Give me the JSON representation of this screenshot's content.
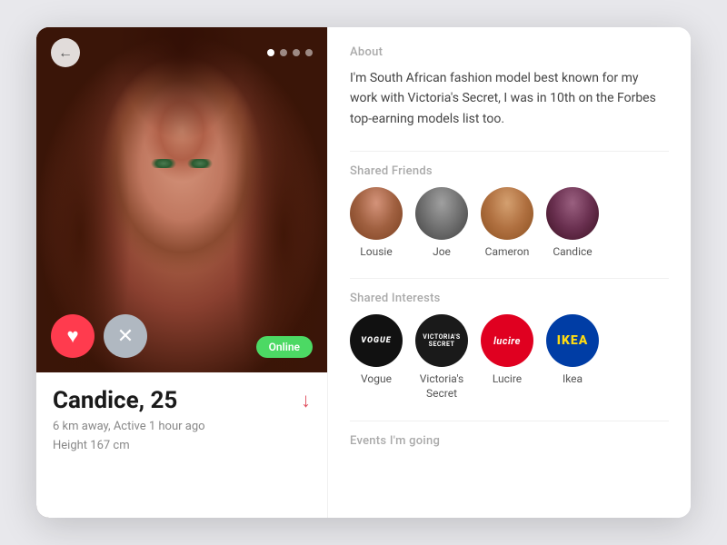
{
  "app": {
    "title": "Dating Profile"
  },
  "left": {
    "back_label": "←",
    "dots": [
      true,
      false,
      false,
      false
    ],
    "online_label": "Online",
    "btn_heart": "♥",
    "btn_x": "✕",
    "name": "Candice, 25",
    "meta_line1": "6 km away, Active 1 hour ago",
    "meta_line2": "Height 167 cm"
  },
  "right": {
    "about_title": "About",
    "about_text": "I'm South African fashion model best known for my work with Victoria's Secret, I was in 10th on the Forbes top-earning models list too.",
    "friends_title": "Shared Friends",
    "friends": [
      {
        "name": "Lousie",
        "css_class": "avatar-lousie"
      },
      {
        "name": "Joe",
        "css_class": "avatar-joe"
      },
      {
        "name": "Cameron",
        "css_class": "avatar-cameron"
      },
      {
        "name": "Candice",
        "css_class": "avatar-candice"
      }
    ],
    "interests_title": "Shared Interests",
    "interests": [
      {
        "name": "Vogue",
        "css_class": "int-vogue",
        "label": "Vogue",
        "text": "VOGUE"
      },
      {
        "name": "Victoria's Secret",
        "css_class": "int-victoria",
        "label": "Victoria's\nSecret",
        "text": "VICTORIA'S\nSECRET"
      },
      {
        "name": "Lucire",
        "css_class": "int-lucire",
        "label": "Lucire",
        "text": "lucire"
      },
      {
        "name": "Ikea",
        "css_class": "int-ikea",
        "label": "Ikea",
        "text": "IKEA"
      }
    ],
    "events_title": "Events I'm going"
  }
}
